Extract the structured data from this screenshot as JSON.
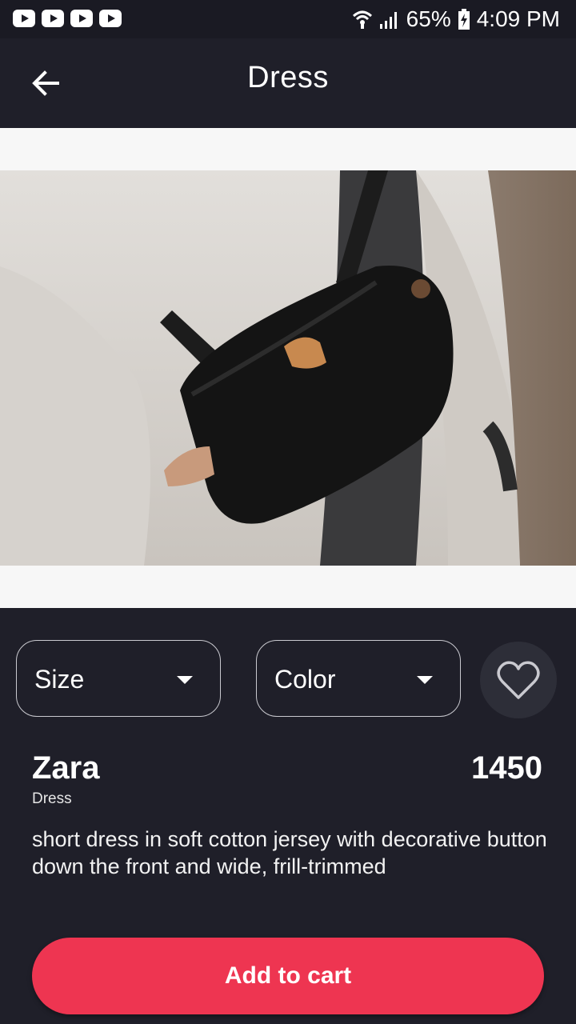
{
  "status_bar": {
    "notifications": [
      "youtube-icon",
      "youtube-icon",
      "youtube-icon",
      "youtube-icon"
    ],
    "battery": "65%",
    "time": "4:09 PM"
  },
  "app_bar": {
    "title": "Dress",
    "back_icon": "arrow-left-icon"
  },
  "product": {
    "image_description": "",
    "selects": {
      "size_label": "Size",
      "color_label": "Color"
    },
    "brand": "Zara",
    "category": "Dress",
    "price": "1450",
    "description": "short dress in soft cotton jersey with decorative button down the front and wide, frill-trimmed",
    "favorite_icon": "heart-outline-icon"
  },
  "actions": {
    "add_to_cart_label": "Add to cart"
  },
  "colors": {
    "background": "#1f1f29",
    "accent": "#ee3551"
  }
}
